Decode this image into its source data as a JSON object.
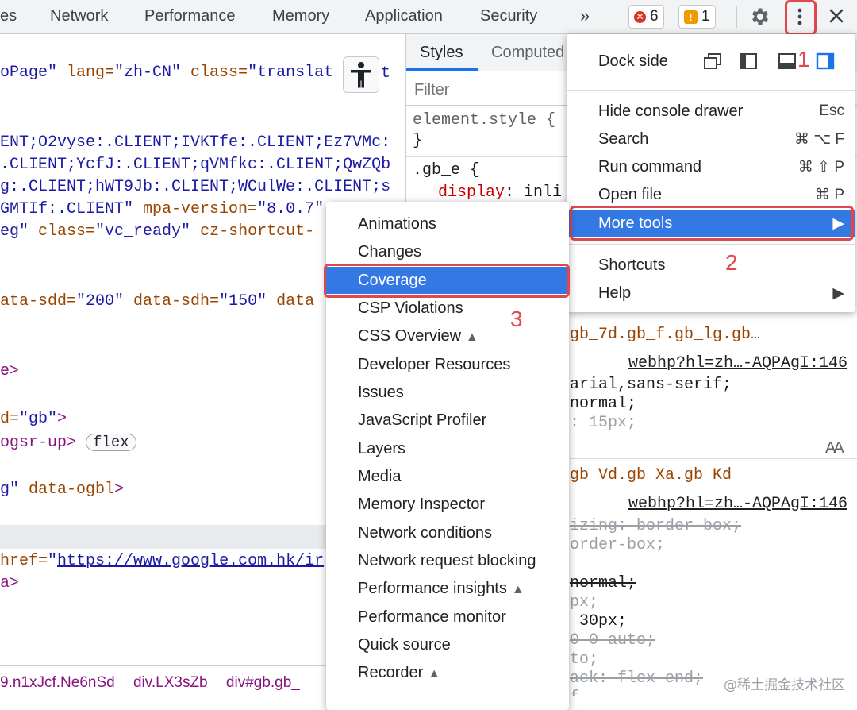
{
  "tabs": [
    "es",
    "Network",
    "Performance",
    "Memory",
    "Application",
    "Security",
    "»"
  ],
  "counters": {
    "errors": "6",
    "warnings": "1"
  },
  "icons": {
    "settings": "gear-icon",
    "more": "kebab-icon",
    "close": "close-icon",
    "a11y": "accessibility-icon"
  },
  "elements_lines": [
    [
      "oPage\" ",
      "lang=",
      "\"zh-CN\" ",
      "class=",
      "\"translat"
    ],
    [
      "ENT;O2vyse:.CLIENT;IVKTfe:.CLIENT;Ez7VMc:"
    ],
    [
      ".CLIENT;YcfJ:.CLIENT;qVMfkc:.CLIENT;QwZQb"
    ],
    [
      "g:.CLIENT;hWT9Jb:.CLIENT;WCulWe:.CLIENT;s"
    ],
    [
      "GMTIf:.CLIENT\" ",
      "mpa-version=",
      "\"8.0.7\""
    ],
    [
      "eg\" ",
      "class=",
      "\"vc_ready\" ",
      "cz-shortcut-"
    ],
    [
      "ata-sdd=",
      "\"200\" ",
      "data-sdh=",
      "\"150\" ",
      "data"
    ],
    [
      "e>"
    ],
    [
      "d=",
      "\"gb\"",
      ">"
    ],
    [
      "ogsr-up>"
    ],
    [
      "g\" ",
      "data-ogbl",
      ">"
    ],
    [
      "href=",
      "\"",
      "https://www.google.com.hk/ir"
    ],
    [
      "a>"
    ]
  ],
  "flex_badge": "flex",
  "breadcrumbs": [
    "9.n1xJcf.Ne6nSd",
    "div.LX3sZb",
    "div#gb.gb_"
  ],
  "styles": {
    "tabs": [
      "Styles",
      "Computed"
    ],
    "filter_placeholder": "Filter",
    "element_style": "element.style {",
    "close_brace": "}",
    "gb_e": ".gb_e {",
    "display_prop": "display",
    "display_val": "inli",
    "rule2_selector": "gb_7d.gb_f.gb_lg.gb…",
    "rule2_source": "webhp?hl=zh…-AQPAgI:146",
    "rule2_lines": [
      "arial,sans-serif;",
      "normal;",
      ": 15px;"
    ],
    "font_icon": "AA",
    "rule3_selector": "gb_Vd.gb_Xa.gb_Kd",
    "rule3_source": "webhp?hl=zh…-AQPAgI:146",
    "rule3_lines": [
      "izing: border-box;",
      "order-box;",
      "normal;",
      "px;",
      " 30px;",
      "0 0 auto;",
      "to;",
      "ack: flex-end;",
      "f"
    ]
  },
  "main_menu": {
    "dock_label": "Dock side",
    "items": [
      {
        "label": "Hide console drawer",
        "shortcut": "Esc"
      },
      {
        "label": "Search",
        "shortcut": "⌘ ⌥ F"
      },
      {
        "label": "Run command",
        "shortcut": "⌘ ⇧ P"
      },
      {
        "label": "Open file",
        "shortcut": "⌘ P"
      },
      {
        "label": "More tools",
        "shortcut": "▶"
      },
      {
        "label": "Shortcuts",
        "shortcut": ""
      },
      {
        "label": "Help",
        "shortcut": "▶"
      }
    ]
  },
  "more_tools": [
    {
      "label": "Animations",
      "flask": false
    },
    {
      "label": "Changes",
      "flask": false
    },
    {
      "label": "Coverage",
      "flask": false
    },
    {
      "label": "CSP Violations",
      "flask": false
    },
    {
      "label": "CSS Overview",
      "flask": true
    },
    {
      "label": "Developer Resources",
      "flask": false
    },
    {
      "label": "Issues",
      "flask": false
    },
    {
      "label": "JavaScript Profiler",
      "flask": false
    },
    {
      "label": "Layers",
      "flask": false
    },
    {
      "label": "Media",
      "flask": false
    },
    {
      "label": "Memory Inspector",
      "flask": false
    },
    {
      "label": "Network conditions",
      "flask": false
    },
    {
      "label": "Network request blocking",
      "flask": false
    },
    {
      "label": "Performance insights",
      "flask": true
    },
    {
      "label": "Performance monitor",
      "flask": false
    },
    {
      "label": "Quick source",
      "flask": false
    },
    {
      "label": "Recorder",
      "flask": true
    }
  ],
  "annotations": [
    "1",
    "2",
    "3"
  ],
  "watermark": "@稀土掘金技术社区",
  "colors": {
    "highlight": "#3478e4",
    "annotation": "#e0474c"
  }
}
